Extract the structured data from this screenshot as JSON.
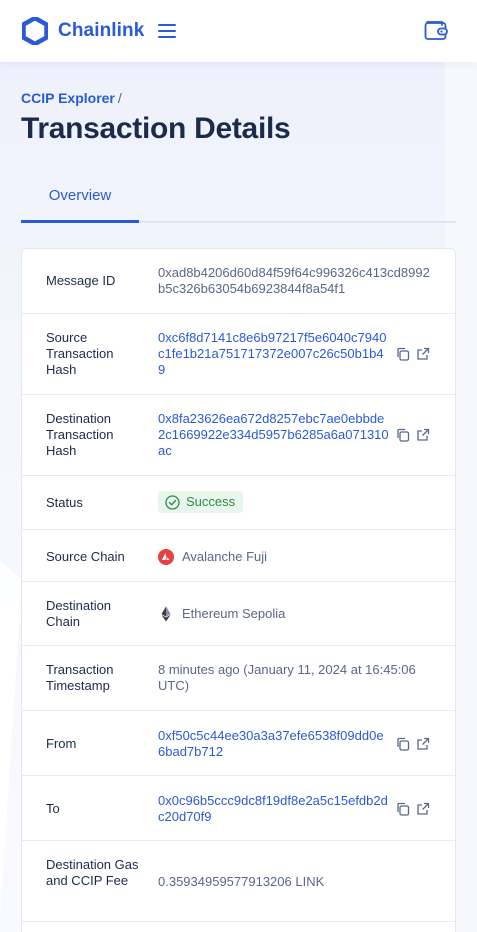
{
  "header": {
    "brand": "Chainlink"
  },
  "breadcrumb": {
    "root": "CCIP Explorer",
    "separator": "/"
  },
  "page_title": "Transaction Details",
  "tabs": [
    {
      "label": "Overview"
    }
  ],
  "details": {
    "message_id": {
      "label": "Message ID",
      "value": "0xad8b4206d60d84f59f64c996326c413cd8992b5c326b63054b6923844f8a54f1"
    },
    "source_tx": {
      "label": "Source Transaction Hash",
      "value": "0xc6f8d7141c8e6b97217f5e6040c7940c1fe1b21a751717372e007c26c50b1b49"
    },
    "dest_tx": {
      "label": "Destination Transaction Hash",
      "value": "0x8fa23626ea672d8257ebc7ae0ebbde2c1669922e334d5957b6285a6a071310ac"
    },
    "status": {
      "label": "Status",
      "value": "Success"
    },
    "source_chain": {
      "label": "Source Chain",
      "value": "Avalanche Fuji"
    },
    "dest_chain": {
      "label": "Destination Chain",
      "value": "Ethereum Sepolia"
    },
    "timestamp": {
      "label": "Transaction Timestamp",
      "value": "8 minutes ago (January 11, 2024 at 16:45:06 UTC)"
    },
    "from": {
      "label": "From",
      "value": "0xf50c5c44ee30a3a37efe6538f09dd0e6bad7b712"
    },
    "to": {
      "label": "To",
      "value": "0x0c96b5ccc9dc8f19df8e2a5c15efdb2dc20d70f9"
    },
    "fee": {
      "label": "Destination Gas and CCIP Fee",
      "value": "0.35934959577913206 LINK"
    }
  },
  "colors": {
    "accent": "#2a5ada",
    "success": "#2e8a4a",
    "avalanche": "#e84142"
  }
}
